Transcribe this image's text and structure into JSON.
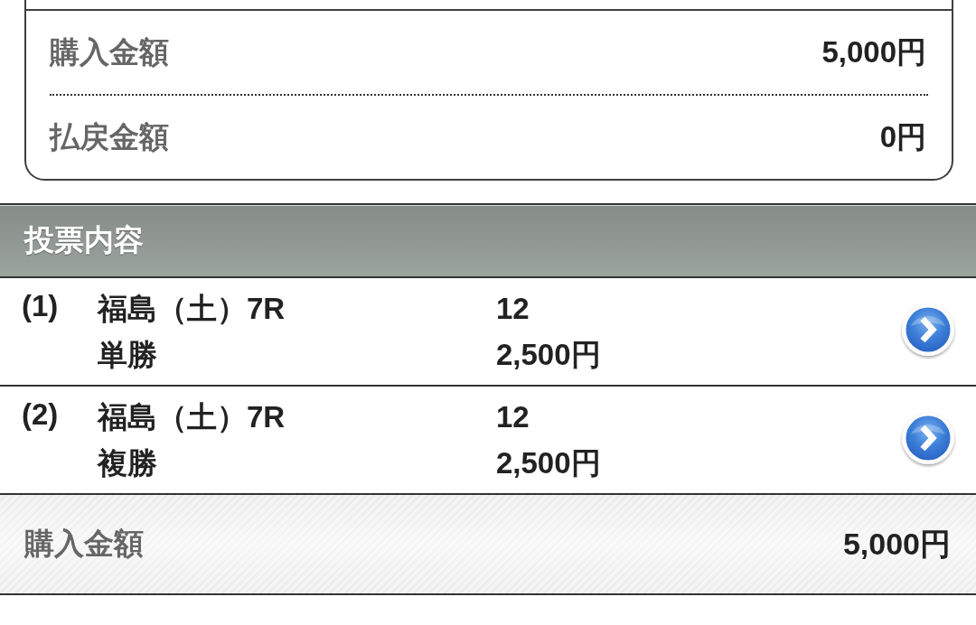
{
  "summary_card": {
    "rows": [
      {
        "label": "購入金額",
        "value": "5,000円"
      },
      {
        "label": "払戻金額",
        "value": "0円"
      }
    ]
  },
  "bets_section": {
    "title": "投票内容",
    "bets": [
      {
        "number": "(1)",
        "race": "福島（土）7R",
        "bet_type": "単勝",
        "selection": "12",
        "amount": "2,500円"
      },
      {
        "number": "(2)",
        "race": "福島（土）7R",
        "bet_type": "複勝",
        "selection": "12",
        "amount": "2,500円"
      }
    ]
  },
  "total": {
    "label": "購入金額",
    "value": "5,000円"
  }
}
